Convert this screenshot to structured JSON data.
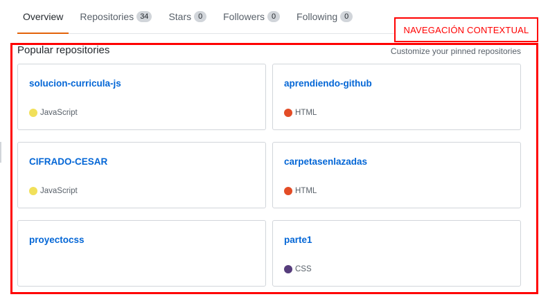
{
  "nav": {
    "tabs": [
      {
        "label": "Overview",
        "count": null,
        "selected": true
      },
      {
        "label": "Repositories",
        "count": "34",
        "selected": false
      },
      {
        "label": "Stars",
        "count": "0",
        "selected": false
      },
      {
        "label": "Followers",
        "count": "0",
        "selected": false
      },
      {
        "label": "Following",
        "count": "0",
        "selected": false
      }
    ],
    "accent_color": "#e36209"
  },
  "annotation": {
    "label": "NAVEGACIÓN CONTEXTUAL",
    "color": "#ff0000"
  },
  "popular": {
    "title": "Popular repositories",
    "customize_label": "Customize your pinned repositories",
    "repos": [
      {
        "name": "solucion-curricula-js",
        "language": "JavaScript",
        "language_color": "#f1e05a"
      },
      {
        "name": "aprendiendo-github",
        "language": "HTML",
        "language_color": "#e34c26"
      },
      {
        "name": "CIFRADO-CESAR",
        "language": "JavaScript",
        "language_color": "#f1e05a"
      },
      {
        "name": "carpetasenlazadas",
        "language": "HTML",
        "language_color": "#e34c26"
      },
      {
        "name": "proyectocss",
        "language": "",
        "language_color": ""
      },
      {
        "name": "parte1",
        "language": "CSS",
        "language_color": "#563d7c"
      }
    ]
  }
}
